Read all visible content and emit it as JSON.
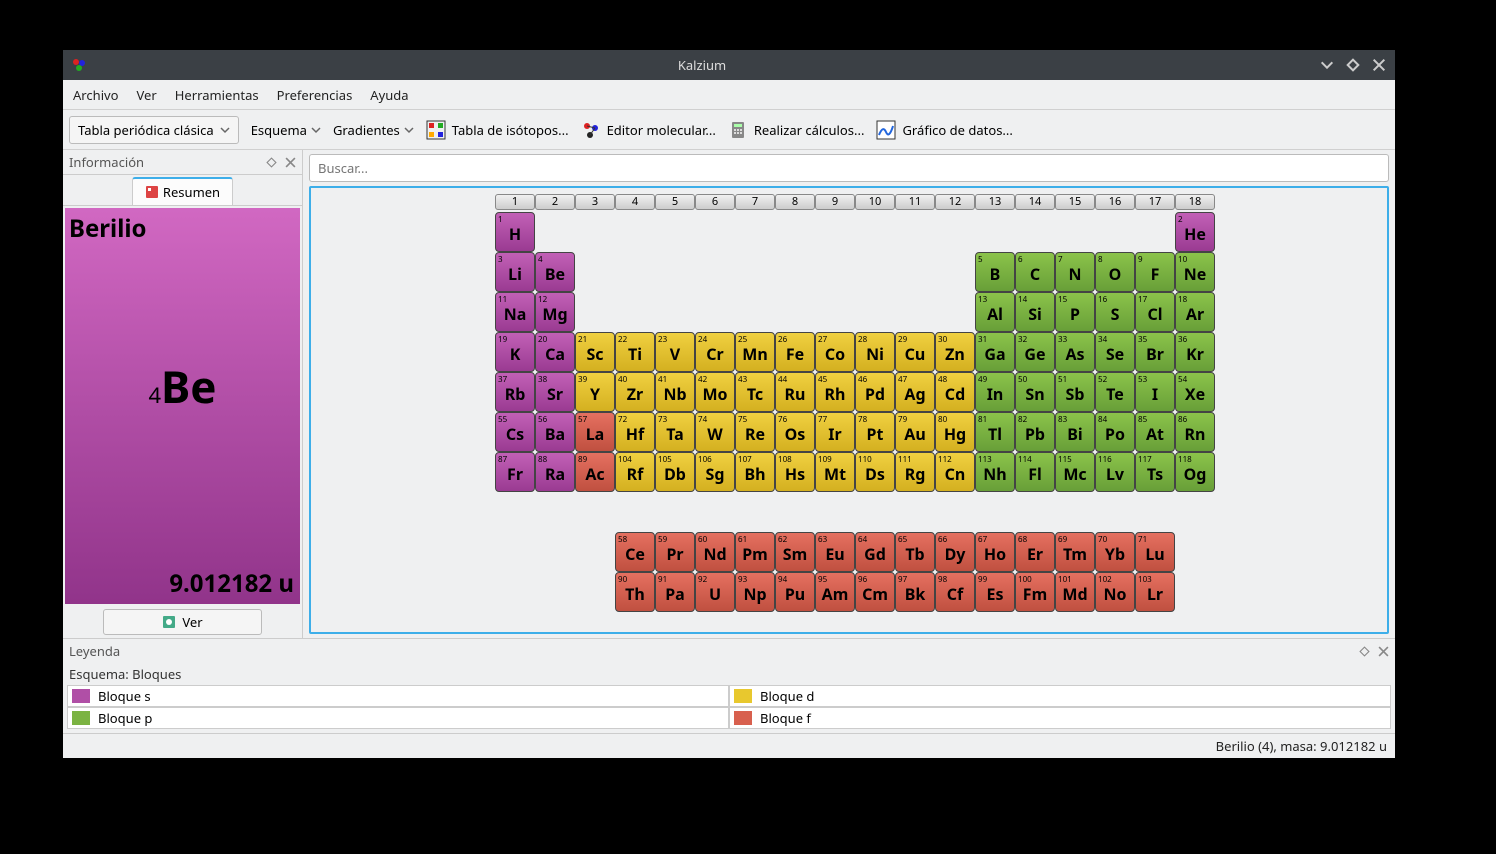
{
  "window": {
    "title": "Kalzium"
  },
  "menu": {
    "archivo": "Archivo",
    "ver": "Ver",
    "herramientas": "Herramientas",
    "preferencias": "Preferencias",
    "ayuda": "Ayuda"
  },
  "toolbar": {
    "table_dropdown": "Tabla periódica clásica",
    "esquema": "Esquema",
    "gradientes": "Gradientes",
    "isotopos": "Tabla de isótopos...",
    "molecular": "Editor molecular...",
    "calculos": "Realizar cálculos...",
    "grafico": "Gráfico de datos..."
  },
  "sidebar": {
    "panel_title": "Información",
    "tab_resumen": "Resumen",
    "element_name": "Berilio",
    "element_number": "4",
    "element_symbol": "Be",
    "element_mass": "9.012182 u",
    "ver_btn": "Ver"
  },
  "search": {
    "placeholder": "Buscar..."
  },
  "groups": [
    "1",
    "2",
    "3",
    "4",
    "5",
    "6",
    "7",
    "8",
    "9",
    "10",
    "11",
    "12",
    "13",
    "14",
    "15",
    "16",
    "17",
    "18"
  ],
  "elements": [
    [
      {
        "n": "1",
        "s": "H",
        "b": "s"
      },
      null,
      null,
      null,
      null,
      null,
      null,
      null,
      null,
      null,
      null,
      null,
      null,
      null,
      null,
      null,
      null,
      {
        "n": "2",
        "s": "He",
        "b": "s"
      }
    ],
    [
      {
        "n": "3",
        "s": "Li",
        "b": "s"
      },
      {
        "n": "4",
        "s": "Be",
        "b": "s"
      },
      null,
      null,
      null,
      null,
      null,
      null,
      null,
      null,
      null,
      null,
      {
        "n": "5",
        "s": "B",
        "b": "p"
      },
      {
        "n": "6",
        "s": "C",
        "b": "p"
      },
      {
        "n": "7",
        "s": "N",
        "b": "p"
      },
      {
        "n": "8",
        "s": "O",
        "b": "p"
      },
      {
        "n": "9",
        "s": "F",
        "b": "p"
      },
      {
        "n": "10",
        "s": "Ne",
        "b": "p"
      }
    ],
    [
      {
        "n": "11",
        "s": "Na",
        "b": "s"
      },
      {
        "n": "12",
        "s": "Mg",
        "b": "s"
      },
      null,
      null,
      null,
      null,
      null,
      null,
      null,
      null,
      null,
      null,
      {
        "n": "13",
        "s": "Al",
        "b": "p"
      },
      {
        "n": "14",
        "s": "Si",
        "b": "p"
      },
      {
        "n": "15",
        "s": "P",
        "b": "p"
      },
      {
        "n": "16",
        "s": "S",
        "b": "p"
      },
      {
        "n": "17",
        "s": "Cl",
        "b": "p"
      },
      {
        "n": "18",
        "s": "Ar",
        "b": "p"
      }
    ],
    [
      {
        "n": "19",
        "s": "K",
        "b": "s"
      },
      {
        "n": "20",
        "s": "Ca",
        "b": "s"
      },
      {
        "n": "21",
        "s": "Sc",
        "b": "d"
      },
      {
        "n": "22",
        "s": "Ti",
        "b": "d"
      },
      {
        "n": "23",
        "s": "V",
        "b": "d"
      },
      {
        "n": "24",
        "s": "Cr",
        "b": "d"
      },
      {
        "n": "25",
        "s": "Mn",
        "b": "d"
      },
      {
        "n": "26",
        "s": "Fe",
        "b": "d"
      },
      {
        "n": "27",
        "s": "Co",
        "b": "d"
      },
      {
        "n": "28",
        "s": "Ni",
        "b": "d"
      },
      {
        "n": "29",
        "s": "Cu",
        "b": "d"
      },
      {
        "n": "30",
        "s": "Zn",
        "b": "d"
      },
      {
        "n": "31",
        "s": "Ga",
        "b": "p"
      },
      {
        "n": "32",
        "s": "Ge",
        "b": "p"
      },
      {
        "n": "33",
        "s": "As",
        "b": "p"
      },
      {
        "n": "34",
        "s": "Se",
        "b": "p"
      },
      {
        "n": "35",
        "s": "Br",
        "b": "p"
      },
      {
        "n": "36",
        "s": "Kr",
        "b": "p"
      }
    ],
    [
      {
        "n": "37",
        "s": "Rb",
        "b": "s"
      },
      {
        "n": "38",
        "s": "Sr",
        "b": "s"
      },
      {
        "n": "39",
        "s": "Y",
        "b": "d"
      },
      {
        "n": "40",
        "s": "Zr",
        "b": "d"
      },
      {
        "n": "41",
        "s": "Nb",
        "b": "d"
      },
      {
        "n": "42",
        "s": "Mo",
        "b": "d"
      },
      {
        "n": "43",
        "s": "Tc",
        "b": "d"
      },
      {
        "n": "44",
        "s": "Ru",
        "b": "d"
      },
      {
        "n": "45",
        "s": "Rh",
        "b": "d"
      },
      {
        "n": "46",
        "s": "Pd",
        "b": "d"
      },
      {
        "n": "47",
        "s": "Ag",
        "b": "d"
      },
      {
        "n": "48",
        "s": "Cd",
        "b": "d"
      },
      {
        "n": "49",
        "s": "In",
        "b": "p"
      },
      {
        "n": "50",
        "s": "Sn",
        "b": "p"
      },
      {
        "n": "51",
        "s": "Sb",
        "b": "p"
      },
      {
        "n": "52",
        "s": "Te",
        "b": "p"
      },
      {
        "n": "53",
        "s": "I",
        "b": "p"
      },
      {
        "n": "54",
        "s": "Xe",
        "b": "p"
      }
    ],
    [
      {
        "n": "55",
        "s": "Cs",
        "b": "s"
      },
      {
        "n": "56",
        "s": "Ba",
        "b": "s"
      },
      {
        "n": "57",
        "s": "La",
        "b": "f"
      },
      {
        "n": "72",
        "s": "Hf",
        "b": "d"
      },
      {
        "n": "73",
        "s": "Ta",
        "b": "d"
      },
      {
        "n": "74",
        "s": "W",
        "b": "d"
      },
      {
        "n": "75",
        "s": "Re",
        "b": "d"
      },
      {
        "n": "76",
        "s": "Os",
        "b": "d"
      },
      {
        "n": "77",
        "s": "Ir",
        "b": "d"
      },
      {
        "n": "78",
        "s": "Pt",
        "b": "d"
      },
      {
        "n": "79",
        "s": "Au",
        "b": "d"
      },
      {
        "n": "80",
        "s": "Hg",
        "b": "d"
      },
      {
        "n": "81",
        "s": "Tl",
        "b": "p"
      },
      {
        "n": "82",
        "s": "Pb",
        "b": "p"
      },
      {
        "n": "83",
        "s": "Bi",
        "b": "p"
      },
      {
        "n": "84",
        "s": "Po",
        "b": "p"
      },
      {
        "n": "85",
        "s": "At",
        "b": "p"
      },
      {
        "n": "86",
        "s": "Rn",
        "b": "p"
      }
    ],
    [
      {
        "n": "87",
        "s": "Fr",
        "b": "s"
      },
      {
        "n": "88",
        "s": "Ra",
        "b": "s"
      },
      {
        "n": "89",
        "s": "Ac",
        "b": "f"
      },
      {
        "n": "104",
        "s": "Rf",
        "b": "d"
      },
      {
        "n": "105",
        "s": "Db",
        "b": "d"
      },
      {
        "n": "106",
        "s": "Sg",
        "b": "d"
      },
      {
        "n": "107",
        "s": "Bh",
        "b": "d"
      },
      {
        "n": "108",
        "s": "Hs",
        "b": "d"
      },
      {
        "n": "109",
        "s": "Mt",
        "b": "d"
      },
      {
        "n": "110",
        "s": "Ds",
        "b": "d"
      },
      {
        "n": "111",
        "s": "Rg",
        "b": "d"
      },
      {
        "n": "112",
        "s": "Cn",
        "b": "d"
      },
      {
        "n": "113",
        "s": "Nh",
        "b": "p"
      },
      {
        "n": "114",
        "s": "Fl",
        "b": "p"
      },
      {
        "n": "115",
        "s": "Mc",
        "b": "p"
      },
      {
        "n": "116",
        "s": "Lv",
        "b": "p"
      },
      {
        "n": "117",
        "s": "Ts",
        "b": "p"
      },
      {
        "n": "118",
        "s": "Og",
        "b": "p"
      }
    ]
  ],
  "fblock": [
    [
      {
        "n": "58",
        "s": "Ce"
      },
      {
        "n": "59",
        "s": "Pr"
      },
      {
        "n": "60",
        "s": "Nd"
      },
      {
        "n": "61",
        "s": "Pm"
      },
      {
        "n": "62",
        "s": "Sm"
      },
      {
        "n": "63",
        "s": "Eu"
      },
      {
        "n": "64",
        "s": "Gd"
      },
      {
        "n": "65",
        "s": "Tb"
      },
      {
        "n": "66",
        "s": "Dy"
      },
      {
        "n": "67",
        "s": "Ho"
      },
      {
        "n": "68",
        "s": "Er"
      },
      {
        "n": "69",
        "s": "Tm"
      },
      {
        "n": "70",
        "s": "Yb"
      },
      {
        "n": "71",
        "s": "Lu"
      }
    ],
    [
      {
        "n": "90",
        "s": "Th"
      },
      {
        "n": "91",
        "s": "Pa"
      },
      {
        "n": "92",
        "s": "U"
      },
      {
        "n": "93",
        "s": "Np"
      },
      {
        "n": "94",
        "s": "Pu"
      },
      {
        "n": "95",
        "s": "Am"
      },
      {
        "n": "96",
        "s": "Cm"
      },
      {
        "n": "97",
        "s": "Bk"
      },
      {
        "n": "98",
        "s": "Cf"
      },
      {
        "n": "99",
        "s": "Es"
      },
      {
        "n": "100",
        "s": "Fm"
      },
      {
        "n": "101",
        "s": "Md"
      },
      {
        "n": "102",
        "s": "No"
      },
      {
        "n": "103",
        "s": "Lr"
      }
    ]
  ],
  "legend": {
    "panel_title": "Leyenda",
    "scheme_title": "Esquema: Bloques",
    "items": [
      {
        "label": "Bloque s",
        "color": "#b04fa6"
      },
      {
        "label": "Bloque d",
        "color": "#e8c82e"
      },
      {
        "label": "Bloque p",
        "color": "#7bb342"
      },
      {
        "label": "Bloque f",
        "color": "#d8604e"
      }
    ]
  },
  "status": "Berilio (4), masa: 9.012182 u"
}
